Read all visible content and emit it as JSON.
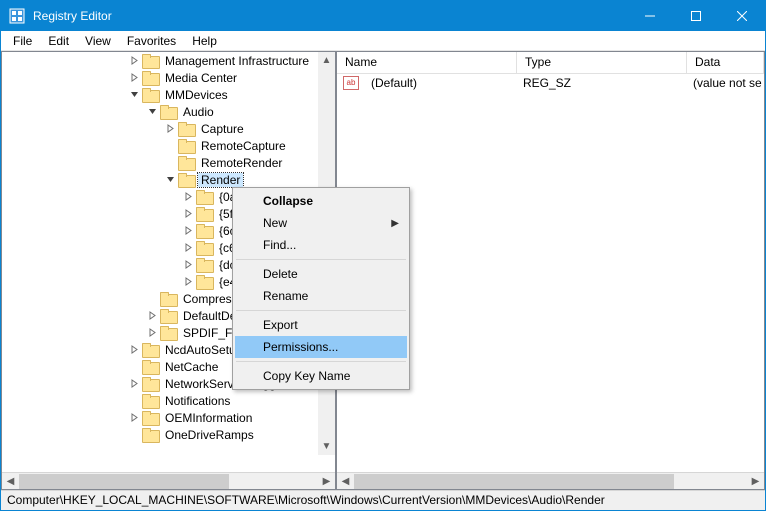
{
  "window": {
    "title": "Registry Editor"
  },
  "menubar": [
    "File",
    "Edit",
    "View",
    "Favorites",
    "Help"
  ],
  "tree": {
    "visible_items": [
      {
        "depth": 7,
        "expander": "collapsed",
        "label": "Management Infrastructure"
      },
      {
        "depth": 7,
        "expander": "collapsed",
        "label": "Media Center"
      },
      {
        "depth": 7,
        "expander": "expanded",
        "label": "MMDevices"
      },
      {
        "depth": 8,
        "expander": "expanded",
        "label": "Audio"
      },
      {
        "depth": 9,
        "expander": "collapsed",
        "label": "Capture"
      },
      {
        "depth": 9,
        "expander": "none",
        "label": "RemoteCapture"
      },
      {
        "depth": 9,
        "expander": "none",
        "label": "RemoteRender"
      },
      {
        "depth": 9,
        "expander": "expanded",
        "label": "Render",
        "selected": true
      },
      {
        "depth": 10,
        "expander": "collapsed",
        "label": "{0a"
      },
      {
        "depth": 10,
        "expander": "collapsed",
        "label": "{5f"
      },
      {
        "depth": 10,
        "expander": "collapsed",
        "label": "{6c"
      },
      {
        "depth": 10,
        "expander": "collapsed",
        "label": "{c6"
      },
      {
        "depth": 10,
        "expander": "collapsed",
        "label": "{dc"
      },
      {
        "depth": 10,
        "expander": "collapsed",
        "label": "{e4"
      },
      {
        "depth": 8,
        "expander": "none",
        "label": "Compress"
      },
      {
        "depth": 8,
        "expander": "collapsed",
        "label": "DefaultDe"
      },
      {
        "depth": 8,
        "expander": "collapsed",
        "label": "SPDIF_For"
      },
      {
        "depth": 7,
        "expander": "collapsed",
        "label": "NcdAutoSetu"
      },
      {
        "depth": 7,
        "expander": "none",
        "label": "NetCache"
      },
      {
        "depth": 7,
        "expander": "collapsed",
        "label": "NetworkServiceTriggers"
      },
      {
        "depth": 7,
        "expander": "none",
        "label": "Notifications"
      },
      {
        "depth": 7,
        "expander": "collapsed",
        "label": "OEMInformation"
      },
      {
        "depth": 7,
        "expander": "none",
        "label": "OneDriveRamps"
      }
    ]
  },
  "list": {
    "headers": {
      "name": "Name",
      "type": "Type",
      "data": "Data"
    },
    "rows": [
      {
        "name": "(Default)",
        "type": "REG_SZ",
        "data": "(value not se"
      }
    ]
  },
  "context_menu": {
    "items": [
      {
        "label": "Collapse",
        "bold": true
      },
      {
        "label": "New",
        "submenu": true
      },
      {
        "label": "Find..."
      },
      {
        "sep": true
      },
      {
        "label": "Delete"
      },
      {
        "label": "Rename"
      },
      {
        "sep": true
      },
      {
        "label": "Export"
      },
      {
        "label": "Permissions...",
        "highlight": true
      },
      {
        "sep": true
      },
      {
        "label": "Copy Key Name"
      }
    ]
  },
  "statusbar": "Computer\\HKEY_LOCAL_MACHINE\\SOFTWARE\\Microsoft\\Windows\\CurrentVersion\\MMDevices\\Audio\\Render"
}
